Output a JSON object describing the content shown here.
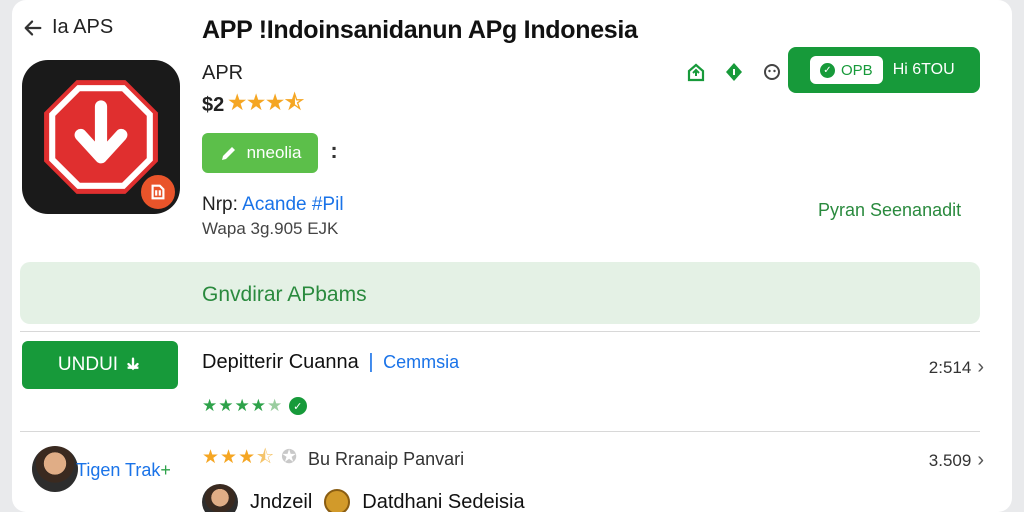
{
  "header": {
    "back_label": "Ia APS",
    "title": "APP !Indoinsanidanun APg Indonesia"
  },
  "app": {
    "developer": "APR",
    "rating_prefix": "$2",
    "install_label": "nneolia",
    "more_label": ":",
    "meta_line1_prefix": "Nrp:",
    "meta_line1_link": "Acande #Pil",
    "meta_line2": "Wapa 3g.905  EJK"
  },
  "actions": {
    "get_chip_label": "OPB",
    "get_label": "Hi 6TOU"
  },
  "side_label": "Pyran Seenanadit",
  "banner": {
    "text": "Gnvdirar APbams"
  },
  "list": {
    "download_button": "UNDUI",
    "row1": {
      "title": "Depitterir Cuanna",
      "separator": "|",
      "subtitle": "Cemmsia",
      "value": "2:514"
    },
    "row2": {
      "user": "Tigen Trak",
      "label": "Bu Rranaip Panvari",
      "value": "3.509"
    },
    "row3": {
      "name": "Jndzeil",
      "title": "Datdhani Sedeisia"
    }
  },
  "colors": {
    "accent_green": "#179a3a",
    "star_gold": "#f5a623",
    "link_blue": "#1a73e8",
    "banner_bg": "#e4f1e5"
  }
}
